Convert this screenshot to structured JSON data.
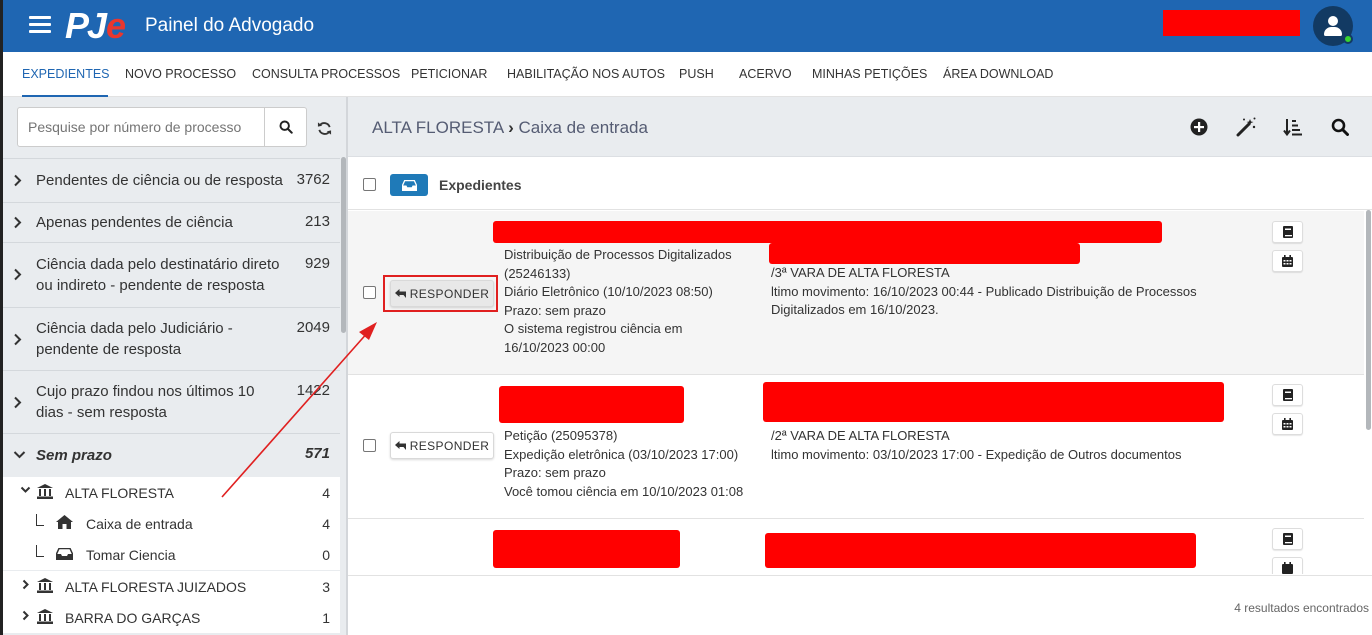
{
  "app": {
    "logo_pj": "PJ",
    "logo_e": "e",
    "title": "Painel do Advogado"
  },
  "nav": {
    "tabs": [
      {
        "label": "EXPEDIENTES",
        "active": true
      },
      {
        "label": "NOVO PROCESSO"
      },
      {
        "label": "CONSULTA PROCESSOS"
      },
      {
        "label": "PETICIONAR"
      },
      {
        "label": "HABILITAÇÃO NOS AUTOS"
      },
      {
        "label": "PUSH"
      },
      {
        "label": "ACERVO"
      },
      {
        "label": "MINHAS PETIÇÕES"
      },
      {
        "label": "ÁREA DOWNLOAD"
      }
    ]
  },
  "sidebar": {
    "search_placeholder": "Pesquise por número de processo",
    "filters": [
      {
        "label": "Pendentes de ciência ou de resposta",
        "count": "3762"
      },
      {
        "label": "Apenas pendentes de ciência",
        "count": "213"
      },
      {
        "label": "Ciência dada pelo destinatário direto ou indireto - pendente de resposta",
        "count": "929"
      },
      {
        "label": "Ciência dada pelo Judiciário - pendente de resposta",
        "count": "2049"
      },
      {
        "label": "Cujo prazo findou nos últimos 10 dias - sem resposta",
        "count": "1422"
      },
      {
        "label": "Sem prazo",
        "count": "571"
      }
    ],
    "tree": [
      {
        "label": "ALTA FLORESTA",
        "count": "4"
      },
      {
        "label": "Caixa de entrada",
        "count": "4"
      },
      {
        "label": "Tomar Ciencia",
        "count": "0"
      },
      {
        "label": "ALTA FLORESTA JUIZADOS",
        "count": "3"
      },
      {
        "label": "BARRA DO GARÇAS",
        "count": "1"
      }
    ]
  },
  "main": {
    "breadcrumb": {
      "root": "ALTA FLORESTA",
      "sep": "›",
      "current": "Caixa de entrada"
    },
    "list_header": "Expedientes",
    "respond_label": "RESPONDER",
    "rows": [
      {
        "col1": [
          "Distribuição de Processos Digitalizados",
          "(25246133)",
          "Diário Eletrônico (10/10/2023 08:50)",
          "Prazo: sem prazo",
          "O sistema registrou ciência em",
          "16/10/2023 00:00"
        ],
        "col2": [
          "/3ª VARA DE ALTA FLORESTA",
          "ltimo movimento: 16/10/2023 00:44 - Publicado Distribuição de Processos",
          "Digitalizados em 16/10/2023."
        ]
      },
      {
        "col1": [
          "Petição (25095378)",
          "Expedição eletrônica (03/10/2023 17:00)",
          "Prazo: sem prazo",
          "Você tomou ciência em 10/10/2023 01:08"
        ],
        "col2": [
          "/2ª VARA DE ALTA FLORESTA",
          "ltimo movimento: 03/10/2023 17:00 - Expedição de Outros documentos"
        ]
      }
    ],
    "results": "4 resultados encontrados"
  },
  "colors": {
    "brand": "#1f66b2",
    "redaction": "#ff0000",
    "annotation": "#e02020"
  }
}
